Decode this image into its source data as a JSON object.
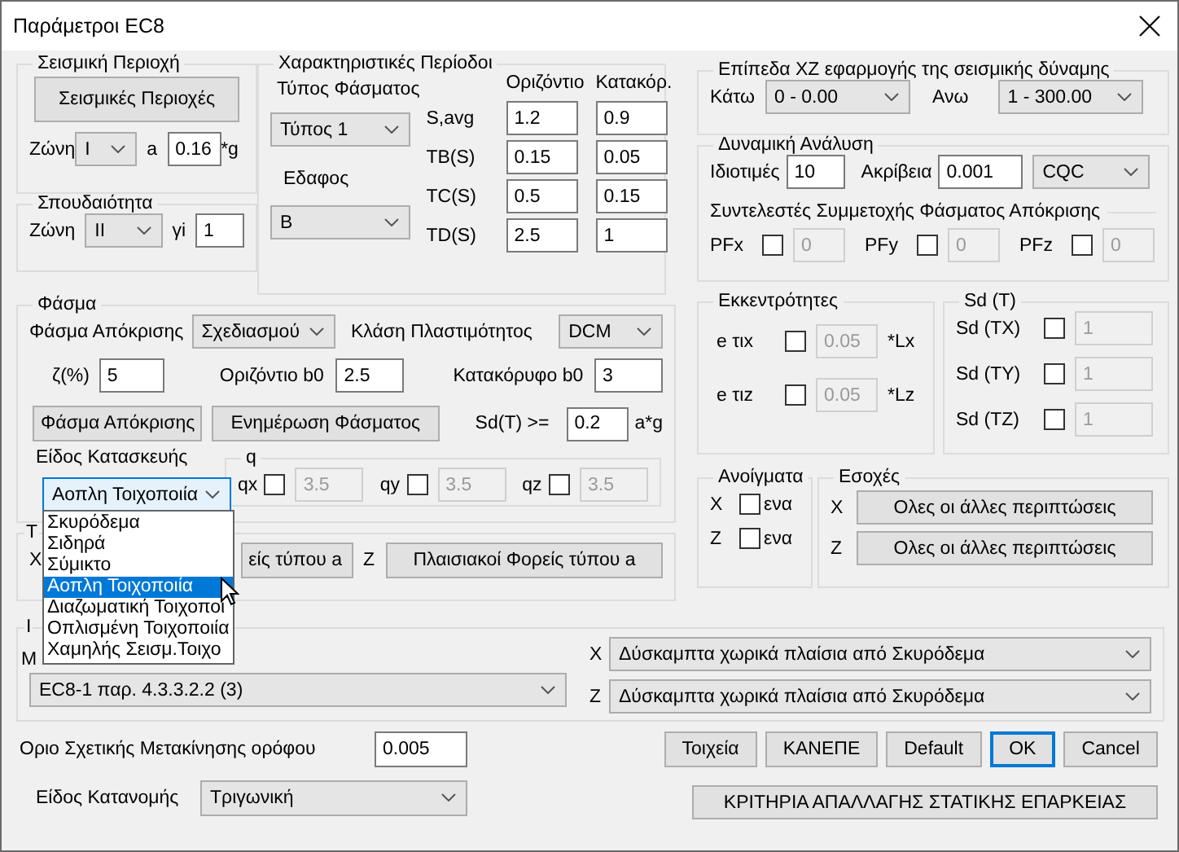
{
  "window": {
    "title": "Παράμετροι EC8"
  },
  "seismic_region": {
    "title": "Σεισμική Περιοχή",
    "button": "Σεισμικές Περιοχές",
    "zone_label": "Ζώνη",
    "zone": "I",
    "a_label": "a",
    "a": "0.16",
    "unit": "*g"
  },
  "importance": {
    "title": "Σπουδαιότητα",
    "zone_label": "Ζώνη",
    "zone": "II",
    "gi_label": "γi",
    "gi": "1"
  },
  "periods": {
    "title": "Χαρακτηριστικές Περίοδοι",
    "spectrum_type_label": "Τύπος Φάσματος",
    "spectrum_type": "Τύπος 1",
    "soil_label": "Εδαφος",
    "soil": "B",
    "columns": [
      "Οριζόντιο",
      "Κατακόρ."
    ],
    "rows": [
      {
        "label": "S,avg",
        "horizontal": "1.2",
        "vertical": "0.9"
      },
      {
        "label": "TB(S)",
        "horizontal": "0.15",
        "vertical": "0.05"
      },
      {
        "label": "TC(S)",
        "horizontal": "0.5",
        "vertical": "0.15"
      },
      {
        "label": "TD(S)",
        "horizontal": "2.5",
        "vertical": "1"
      }
    ]
  },
  "xz_levels": {
    "title": "Επίπεδα XZ εφαρμογής της σεισμικής δύναμης",
    "lower_label": "Κάτω",
    "lower": "0 - 0.00",
    "upper_label": "Ανω",
    "upper": "1 - 300.00"
  },
  "dynamic": {
    "title": "Δυναμική Ανάλυση",
    "modes_label": "Ιδιοτιμές",
    "modes": "10",
    "accuracy_label": "Ακρίβεια",
    "accuracy": "0.001",
    "method": "CQC",
    "factors_title": "Συντελεστές Συμμετοχής Φάσματος Απόκρισης",
    "factors": [
      {
        "label": "PFx",
        "checked": false,
        "value": "0",
        "disabled": true
      },
      {
        "label": "PFy",
        "checked": false,
        "value": "0",
        "disabled": true
      },
      {
        "label": "PFz",
        "checked": false,
        "value": "0",
        "disabled": true
      }
    ]
  },
  "spectrum": {
    "title": "Φάσμα",
    "response_label": "Φάσμα Απόκρισης",
    "response": "Σχεδιασμού",
    "ductility_label": "Κλάση Πλαστιμότητος",
    "ductility": "DCM",
    "damping_label": "ζ(%)",
    "damping": "5",
    "h_b0_label": "Οριζόντιο b0",
    "h_b0": "2.5",
    "v_b0_label": "Κατακόρυφο b0",
    "v_b0": "3",
    "buttons": [
      "Φάσμα Απόκρισης",
      "Ενημέρωση Φάσματος"
    ],
    "sd_label": "Sd(T) >=",
    "sd": "0.2",
    "sd_unit": "a*g",
    "construction_label": "Είδος Κατασκευής",
    "construction": {
      "value": "Αοπλη Τοιχοποιία",
      "focused": true,
      "expanded": true,
      "options": [
        {
          "label": "Σκυρόδεμα",
          "selected": false
        },
        {
          "label": "Σιδηρά",
          "selected": false
        },
        {
          "label": "Σύμικτο",
          "selected": false
        },
        {
          "label": "Αοπλη Τοιχοποιία",
          "selected": true
        },
        {
          "label": "Διαζωματική Τοιχοποι",
          "selected": false
        },
        {
          "label": "Οπλισμένη Τοιχοποιία",
          "selected": false
        },
        {
          "label": "Χαμηλής Σεισμ.Τοιχο",
          "selected": false
        }
      ]
    },
    "q": {
      "title": "q",
      "items": [
        {
          "label": "qx",
          "checked": false,
          "value": "3.5",
          "disabled": true
        },
        {
          "label": "qy",
          "checked": false,
          "value": "3.5",
          "disabled": true
        },
        {
          "label": "qz",
          "checked": false,
          "value": "3.5",
          "disabled": true
        }
      ]
    }
  },
  "frame_type": {
    "title": "Τ",
    "x_label": "X",
    "x_button": "είς τύπου a",
    "z_label": "Z",
    "z_button": "Πλαισιακοί Φορείς τύπου a"
  },
  "eccentricity": {
    "title": "Εκκεντρότητες",
    "items": [
      {
        "label": "e τιx",
        "checked": false,
        "value": "0.05",
        "disabled": true,
        "unit": "*Lx"
      },
      {
        "label": "e τιz",
        "checked": false,
        "value": "0.05",
        "disabled": true,
        "unit": "*Lz"
      }
    ]
  },
  "sd_t": {
    "title": "Sd (T)",
    "items": [
      {
        "label": "Sd (TX)",
        "checked": false,
        "value": "1",
        "disabled": true
      },
      {
        "label": "Sd (TY)",
        "checked": false,
        "value": "1",
        "disabled": true
      },
      {
        "label": "Sd (TZ)",
        "checked": false,
        "value": "1",
        "disabled": true
      }
    ]
  },
  "openings": {
    "title": "Ανοίγματα",
    "items": [
      {
        "axis": "X",
        "label": "ενα",
        "checked": false
      },
      {
        "axis": "Z",
        "label": "ενα",
        "checked": false
      }
    ]
  },
  "setbacks": {
    "title": "Εσοχές",
    "items": [
      {
        "axis": "X",
        "button": "Ολες οι άλλες περιπτώσεις"
      },
      {
        "axis": "Z",
        "button": "Ολες οι άλλες περιπτώσεις"
      }
    ]
  },
  "regularity": {
    "title": "Ι",
    "label": "Μ",
    "method": "EC8-1 παρ. 4.3.3.2.2 (3)",
    "systems": [
      {
        "axis": "X",
        "value": "Δύσκαμπτα χωρικά πλαίσια από Σκυρόδεμα"
      },
      {
        "axis": "Z",
        "value": "Δύσκαμπτα χωρικά πλαίσια από Σκυρόδεμα"
      }
    ]
  },
  "drift": {
    "label": "Οριο Σχετικής Μετακίνησης ορόφου",
    "value": "0.005"
  },
  "distribution": {
    "label": "Είδος Κατανομής",
    "value": "Τριγωνική"
  },
  "buttons": [
    {
      "label": "Τοιχεία",
      "default": false
    },
    {
      "label": "ΚΑΝΕΠΕ",
      "default": false
    },
    {
      "label": "Default",
      "default": false
    },
    {
      "label": "OK",
      "default": true
    },
    {
      "label": "Cancel",
      "default": false
    }
  ],
  "criteria_button": "ΚΡΙΤΗΡΙΑ ΑΠΑΛΛΑΓΗΣ ΣΤΑΤΙΚΗΣ ΕΠΑΡΚΕΙΑΣ"
}
